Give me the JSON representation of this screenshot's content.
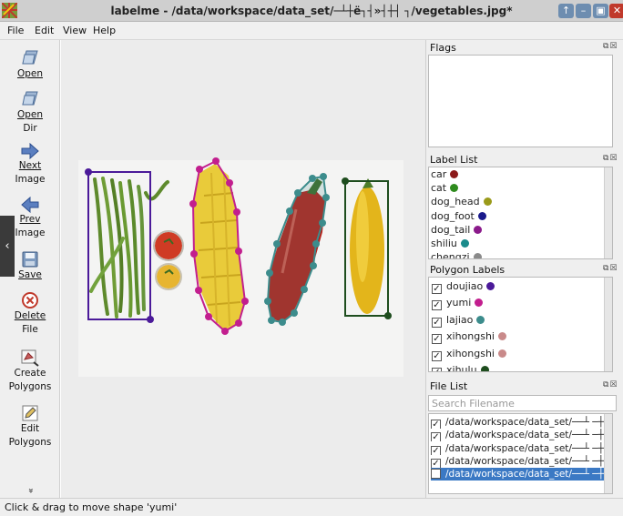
{
  "window": {
    "title": "labelme - /data/workspace/data_set/─┴┼ë┐┤»┤┼┤ ┐/vegetables.jpg*",
    "controls": [
      "↑",
      "–",
      "▣",
      "✕"
    ]
  },
  "menu": [
    "File",
    "Edit",
    "View",
    "Help"
  ],
  "toolbar": {
    "open": [
      "Open"
    ],
    "open_dir": [
      "Open",
      "Dir"
    ],
    "next_image": [
      "Next",
      "Image"
    ],
    "prev_image": [
      "Prev",
      "Image"
    ],
    "save": [
      "Save"
    ],
    "delete_file": [
      "Delete",
      "File"
    ],
    "create_polygons": [
      "Create",
      "Polygons"
    ],
    "edit_polygons": [
      "Edit",
      "Polygons"
    ],
    "more": "»"
  },
  "canvas": {
    "prev_tab": "‹",
    "next_tab": "›"
  },
  "dock": {
    "flags_title": "Flags",
    "label_list_title": "Label List",
    "label_list": [
      {
        "name": "car",
        "color": "#8b1a1a"
      },
      {
        "name": "cat",
        "color": "#2e8b1e"
      },
      {
        "name": "dog_head",
        "color": "#9a9a1a"
      },
      {
        "name": "dog_foot",
        "color": "#1a1a8b"
      },
      {
        "name": "dog_tail",
        "color": "#8b1a8b"
      },
      {
        "name": "shiliu",
        "color": "#1a8b8b"
      },
      {
        "name": "chengzi",
        "color": "#8a8a8a"
      }
    ],
    "polygon_labels_title": "Polygon Labels",
    "polygon_labels": [
      {
        "name": "doujiao",
        "color": "#4b1a99",
        "checked": true
      },
      {
        "name": "yumi",
        "color": "#c21e8e",
        "checked": true
      },
      {
        "name": "lajiao",
        "color": "#3c8c8c",
        "checked": true
      },
      {
        "name": "xihongshi",
        "color": "#c98a8a",
        "checked": true
      },
      {
        "name": "xihongshi",
        "color": "#c98a8a",
        "checked": true
      },
      {
        "name": "xihulu",
        "color": "#1e4d1e",
        "checked": true
      }
    ],
    "file_list_title": "File List",
    "search_placeholder": "Search Filename",
    "files": [
      {
        "path": "/data/workspace/data_set/──┴ ─┼ë▒",
        "checked": true,
        "selected": false
      },
      {
        "path": "/data/workspace/data_set/──┴ ─┼ë▒",
        "checked": true,
        "selected": false
      },
      {
        "path": "/data/workspace/data_set/──┴ ─┼ë▒",
        "checked": true,
        "selected": false
      },
      {
        "path": "/data/workspace/data_set/──┴ ─┼ë▒",
        "checked": true,
        "selected": false
      },
      {
        "path": "/data/workspace/data_set/──┴ ─┼ë▒",
        "checked": false,
        "selected": true
      }
    ],
    "panel_controls": "⧉☒"
  },
  "status": {
    "text": "Click & drag to move shape 'yumi'"
  },
  "colors": {
    "doujiao": "#4b1a99",
    "yumi": "#c21e8e",
    "lajiao": "#3c8c8c",
    "xihulu": "#1e4d1e",
    "selection": "#3b79c4"
  }
}
